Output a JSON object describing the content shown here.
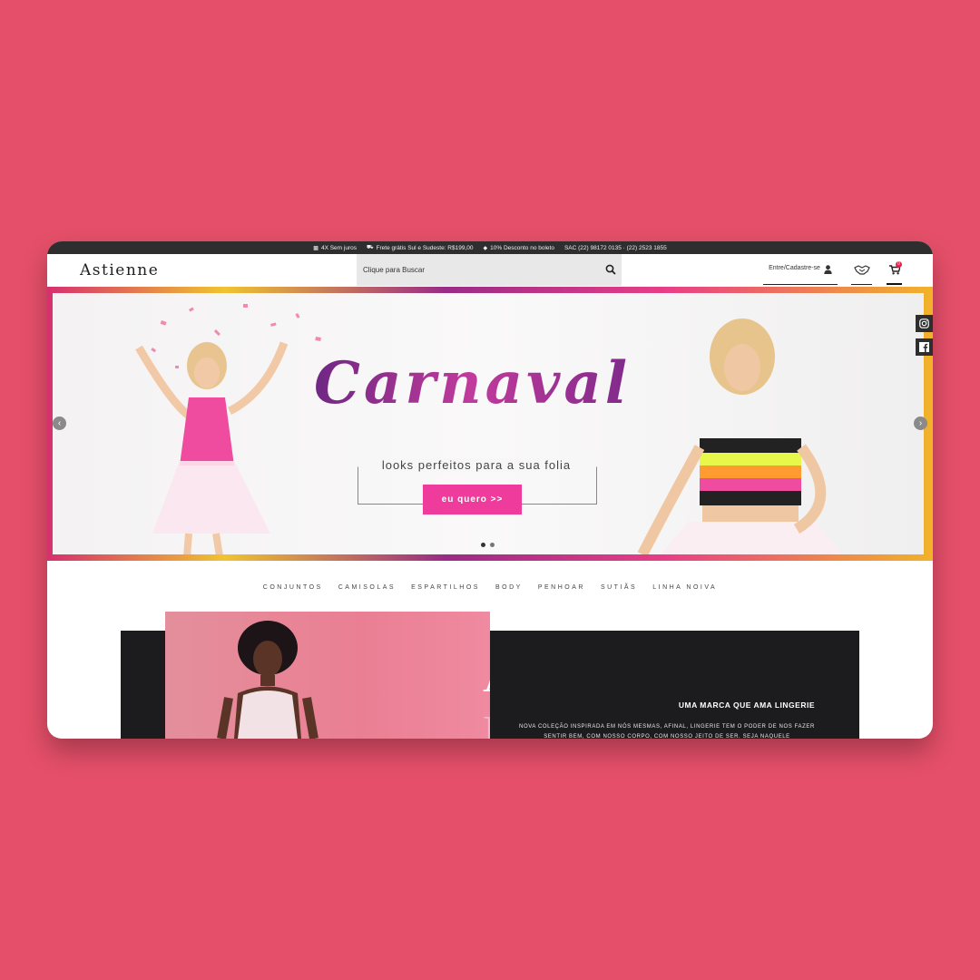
{
  "topbar": {
    "installments": "4X Sem juros",
    "shipping": "Frete grátis Sul e Sudeste: R$199,00",
    "discount": "10% Desconto no boleto",
    "sac": "SAC (22) 98172 0135 · (22) 2523 1855"
  },
  "header": {
    "logo": "Astienne",
    "search_placeholder": "Clique para Buscar",
    "account_label": "Entre/Cadastre-se",
    "cart_count": "0"
  },
  "hero": {
    "title": "Carnaval",
    "subtitle": "looks perfeitos para a sua folia",
    "button": "eu quero >>",
    "slides": 2,
    "active_slide": 0,
    "colors": {
      "border": "#e8359a",
      "button": "#ef3b9c",
      "title": "#8b2c8a"
    }
  },
  "social": {
    "instagram": "instagram-icon",
    "facebook": "facebook-icon"
  },
  "categories": [
    "CONJUNTOS",
    "CAMISOLAS",
    "ESPARTILHOS",
    "BODY",
    "PENHOAR",
    "SUTIÃS",
    "LINHA NOIVA"
  ],
  "promo": {
    "image_text_line1": "AMO",
    "image_text_line2": "LIN",
    "title": "UMA MARCA QUE AMA LINGERIE",
    "description": "NOVA COLEÇÃO INSPIRADA EM NÓS MESMAS, AFINAL, LINGERIE TEM O PODER DE NOS FAZER SENTIR BEM, COM NOSSO CORPO, COM NOSSO JEITO DE SER. SEJA NAQUELE"
  }
}
